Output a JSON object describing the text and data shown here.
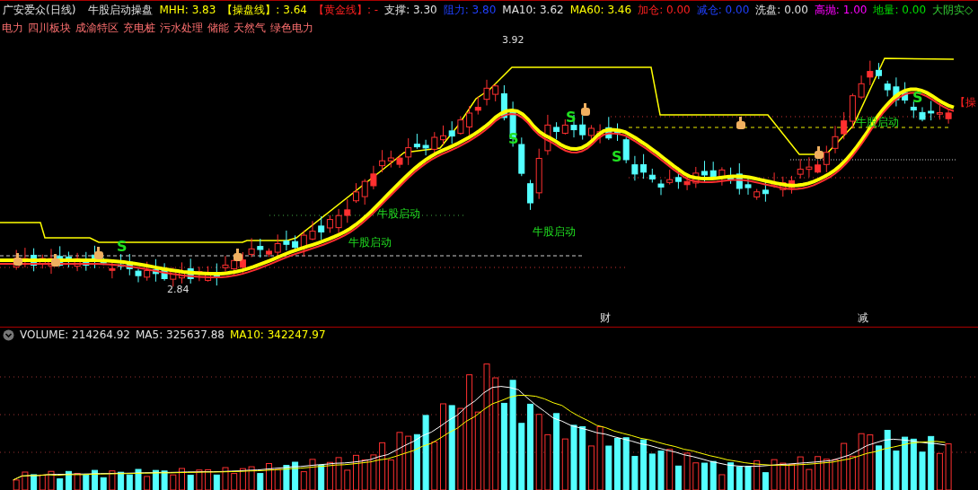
{
  "window": {
    "title": "广安爱众(日线)"
  },
  "indicator": {
    "name": "牛股启动操盘"
  },
  "header_values": [
    {
      "label": "MHH:",
      "value": "3.83",
      "color": "#ffff00"
    },
    {
      "label": "【操盘线】:",
      "value": "3.64",
      "color": "#ffff00"
    },
    {
      "label": "【黄金线】:",
      "value": "-",
      "color": "#ff2020"
    },
    {
      "label": "支撑:",
      "value": "3.30",
      "color": "#e0e0e0"
    },
    {
      "label": "阻力:",
      "value": "3.80",
      "color": "#2040ff"
    },
    {
      "label": "MA10:",
      "value": "3.62",
      "color": "#e0e0e0"
    },
    {
      "label": "MA60:",
      "value": "3.46",
      "color": "#ffff00"
    },
    {
      "label": "加仓:",
      "value": "0.00",
      "color": "#ff2020"
    },
    {
      "label": "减仓:",
      "value": "0.00",
      "color": "#2040ff"
    },
    {
      "label": "洗盘:",
      "value": "0.00",
      "color": "#e0e0e0"
    },
    {
      "label": "高抛:",
      "value": "1.00",
      "color": "#ff00ff"
    },
    {
      "label": "地量:",
      "value": "0.00",
      "color": "#00e000"
    }
  ],
  "mode_label": "大阴实◇",
  "sectors": [
    "电力",
    "四川板块",
    "成渝特区",
    "充电桩",
    "污水处理",
    "储能",
    "天然气",
    "绿色电力"
  ],
  "chart_labels": [
    {
      "kind": "signal",
      "text": "牛股启动"
    },
    {
      "kind": "signal",
      "text": "牛股启动"
    },
    {
      "kind": "signal",
      "text": "牛股启动"
    },
    {
      "kind": "signal",
      "text": "牛股启动"
    },
    {
      "kind": "s",
      "text": "S"
    },
    {
      "kind": "s",
      "text": "S"
    },
    {
      "kind": "s",
      "text": "S"
    },
    {
      "kind": "s",
      "text": "S"
    },
    {
      "kind": "s",
      "text": "S"
    },
    {
      "kind": "price",
      "text": "3.92"
    },
    {
      "kind": "price",
      "text": "2.84"
    },
    {
      "kind": "event",
      "text": "财"
    },
    {
      "kind": "event",
      "text": "减"
    },
    {
      "kind": "line",
      "text": "【操"
    }
  ],
  "volume": {
    "values": [
      {
        "label": "VOLUME:",
        "value": "214264.92",
        "color": "#e0e0e0"
      },
      {
        "label": "MA5:",
        "value": "325637.88",
        "color": "#e0e0e0"
      },
      {
        "label": "MA10:",
        "value": "342247.97",
        "color": "#ffff00"
      }
    ]
  }
}
